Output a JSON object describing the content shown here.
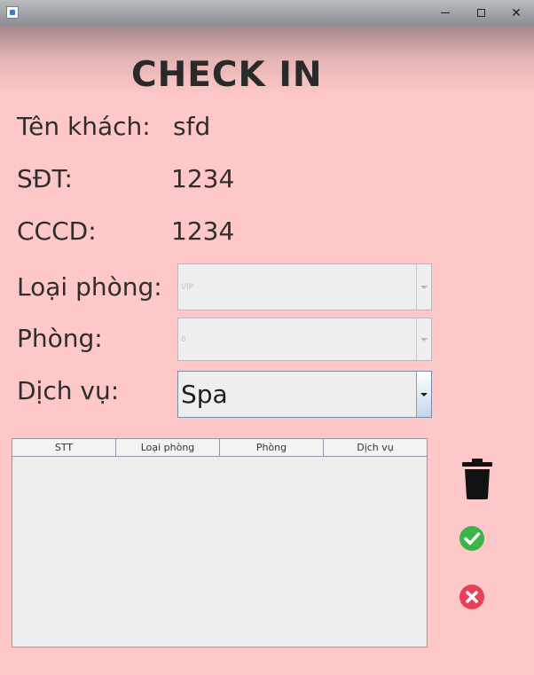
{
  "window": {
    "minimize_icon": "minimize-icon",
    "maximize_icon": "maximize-icon",
    "close_glyph": "✕"
  },
  "form": {
    "title": "CHECK IN",
    "guest_name_label": "Tên khách:",
    "guest_name_value": "sfd",
    "phone_label": "SĐT:",
    "phone_value": "1234",
    "id_label": "CCCD:",
    "id_value": "1234",
    "room_type_label": "Loại phòng:",
    "room_type_value": "VIP",
    "room_label": "Phòng:",
    "room_value": "6",
    "service_label": "Dịch vụ:",
    "service_value": "Spa"
  },
  "table": {
    "columns": [
      "STT",
      "Loại phòng",
      "Phòng",
      "Dịch vụ"
    ],
    "rows": []
  },
  "actions": {
    "delete_icon": "trash-icon",
    "confirm_icon": "check-circle-icon",
    "cancel_icon": "x-circle-icon"
  },
  "colors": {
    "background": "#ffc8c8",
    "confirm": "#3bb54a",
    "cancel": "#e9405a"
  }
}
